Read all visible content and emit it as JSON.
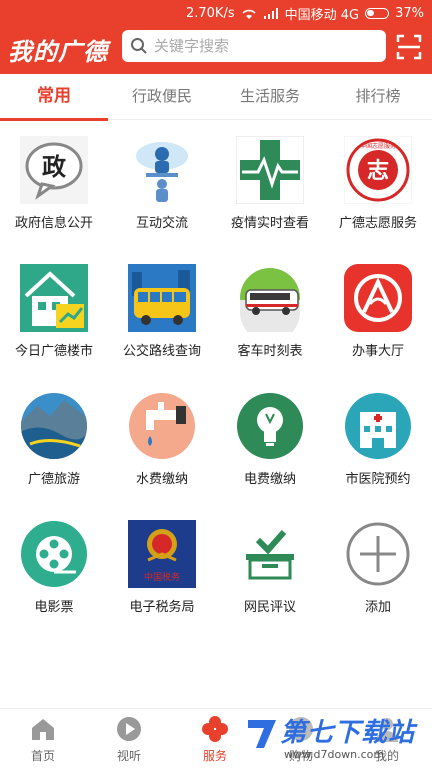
{
  "status": {
    "speed": "2.70K/s",
    "carrier": "中国移动 4G",
    "battery": "37%"
  },
  "app": {
    "logo": "我的广德"
  },
  "search": {
    "placeholder": "关键字搜索"
  },
  "tabs": [
    {
      "label": "常用",
      "active": true
    },
    {
      "label": "行政便民",
      "active": false
    },
    {
      "label": "生活服务",
      "active": false
    },
    {
      "label": "排行榜",
      "active": false
    }
  ],
  "grid": [
    {
      "label": "政府信息公开",
      "icon": "government-info-icon",
      "glyph": "政"
    },
    {
      "label": "互动交流",
      "icon": "interaction-icon"
    },
    {
      "label": "疫情实时查看",
      "icon": "epidemic-cross-icon"
    },
    {
      "label": "广德志愿服务",
      "icon": "volunteer-emblem-icon",
      "glyph": "志",
      "badge_text": "中国志愿服务"
    },
    {
      "label": "今日广德楼市",
      "icon": "real-estate-icon"
    },
    {
      "label": "公交路线查询",
      "icon": "bus-icon"
    },
    {
      "label": "客车时刻表",
      "icon": "coach-icon"
    },
    {
      "label": "办事大厅",
      "icon": "service-hall-icon"
    },
    {
      "label": "广德旅游",
      "icon": "travel-icon"
    },
    {
      "label": "水费缴纳",
      "icon": "water-tap-icon"
    },
    {
      "label": "电费缴纳",
      "icon": "lightbulb-icon"
    },
    {
      "label": "市医院预约",
      "icon": "hospital-icon"
    },
    {
      "label": "电影票",
      "icon": "film-reel-icon"
    },
    {
      "label": "电子税务局",
      "icon": "tax-emblem-icon",
      "badge_text": "中国税务"
    },
    {
      "label": "网民评议",
      "icon": "vote-box-icon"
    },
    {
      "label": "添加",
      "icon": "add-icon"
    }
  ],
  "bottom_nav": [
    {
      "label": "首页",
      "icon": "home-icon"
    },
    {
      "label": "视听",
      "icon": "play-icon"
    },
    {
      "label": "服务",
      "icon": "service-clover-icon",
      "active": true
    },
    {
      "label": "购物",
      "icon": "shopping-icon"
    },
    {
      "label": "我的",
      "icon": "profile-icon"
    }
  ],
  "watermark": {
    "title": "第七下载站",
    "url": "www.d7down.com"
  },
  "colors": {
    "brand": "#e8402c",
    "active_tab": "#e8402c"
  }
}
